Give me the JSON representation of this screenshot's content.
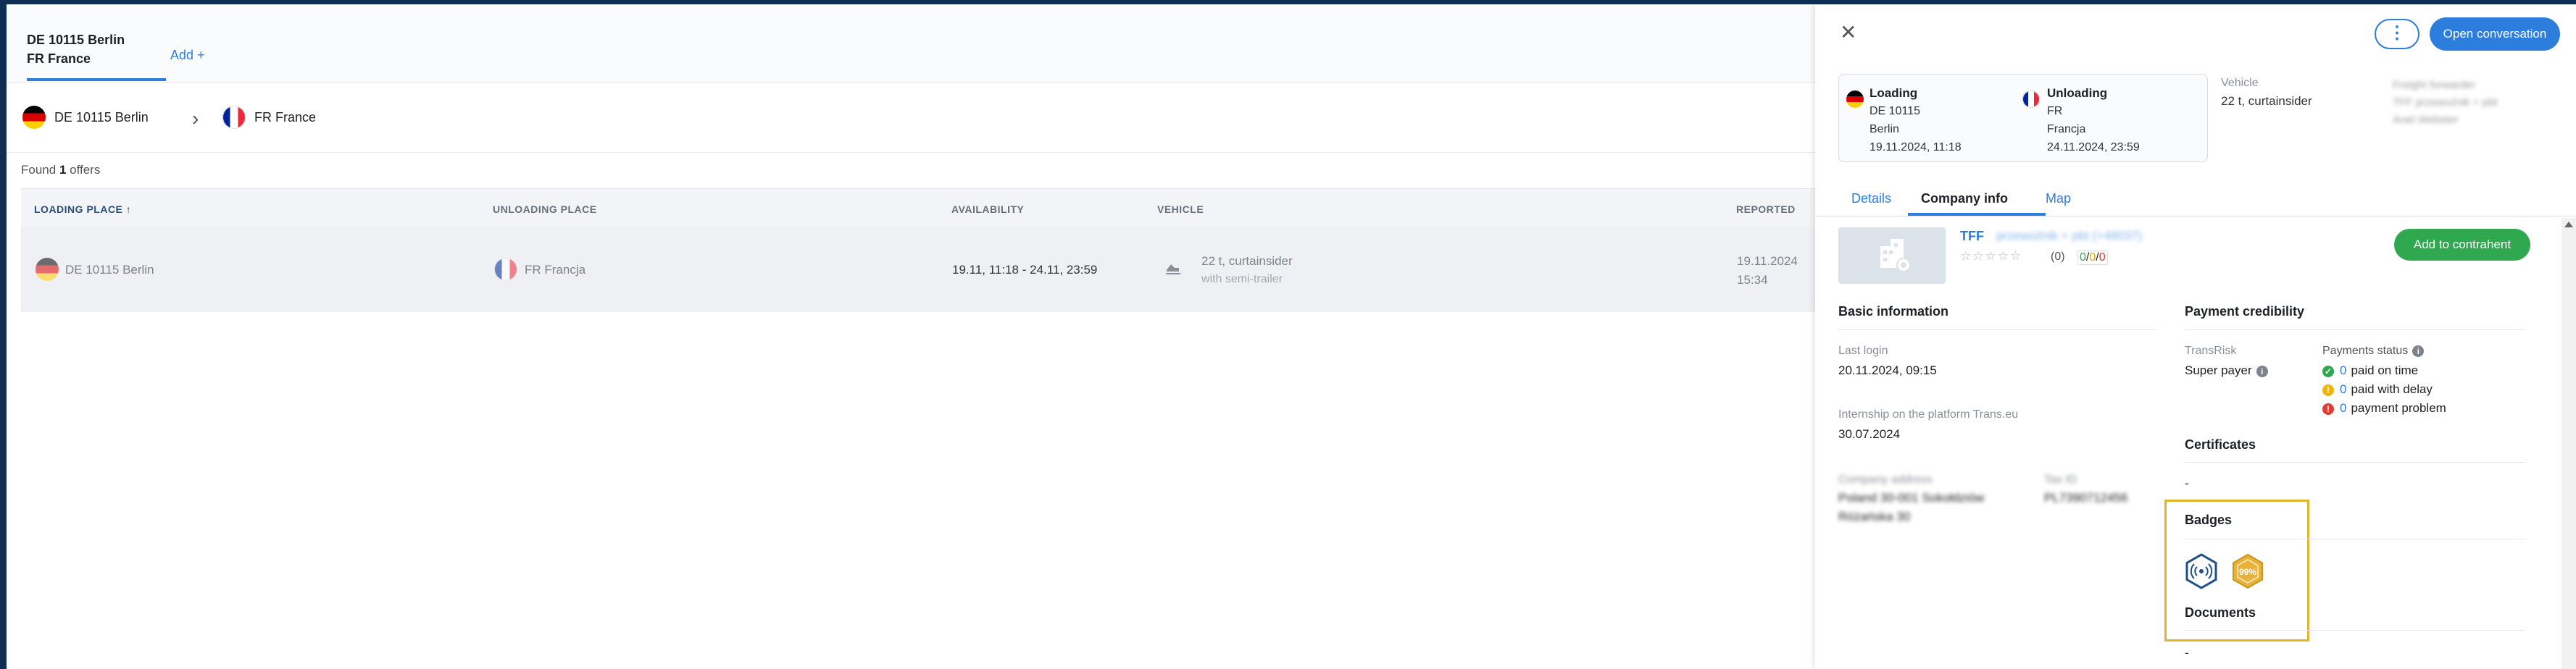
{
  "search_tab": {
    "line1": "DE 10115 Berlin",
    "line2": "FR France"
  },
  "add_tab": "Add +",
  "route": {
    "from": "DE 10115 Berlin",
    "to": "FR France"
  },
  "found": {
    "prefix": "Found ",
    "count": "1",
    "suffix": " offers"
  },
  "table": {
    "headers": {
      "loading": "LOADING PLACE",
      "unloading": "UNLOADING PLACE",
      "availability": "AVAILABILITY",
      "vehicle": "VEHICLE",
      "reported": "REPORTED"
    },
    "row": {
      "loading": "DE 10115 Berlin",
      "unloading": "FR Francja",
      "availability": "19.11, 11:18 - 24.11, 23:59",
      "vehicle_line1": "22 t, curtainsider",
      "vehicle_line2": "with semi-trailer",
      "reported_date": "19.11.2024",
      "reported_time": "15:34"
    }
  },
  "drawer": {
    "close": "✕",
    "more": "⋮",
    "open_conversation": "Open conversation",
    "loading": {
      "title": "Loading",
      "line1": "DE 10115",
      "line2": "Berlin",
      "line3": "19.11.2024, 11:18"
    },
    "unloading": {
      "title": "Unloading",
      "line1": "FR",
      "line2": "Francja",
      "line3": "24.11.2024, 23:59"
    },
    "vehicle_label": "Vehicle",
    "vehicle_value": "22 t, curtainsider",
    "forwarder_blur": [
      "Freight forwarder",
      "TFF przewoźnik + pbt",
      "Anet Webster"
    ],
    "tabs": [
      "Details",
      "Company info",
      "Map"
    ],
    "company": {
      "name": "TFF",
      "name_blur": "przewoźnik + pbt  (+48037)",
      "stars": "☆☆☆☆☆",
      "rating": "(0)",
      "ratio": {
        "a": "0",
        "b": "0",
        "c": "0"
      },
      "add_to_contrahent": "Add to contrahent"
    },
    "basic_info": {
      "title": "Basic information",
      "last_login_label": "Last login",
      "last_login_value": "20.11.2024, 09:15",
      "internship_label": "Internship on the platform Trans.eu",
      "internship_value": "30.07.2024",
      "blur_address_label": "Company address",
      "blur_address_value": [
        "Poland 30-001 Sokołdziów",
        "Różańska 30"
      ],
      "blur_tax_label": "Tax ID",
      "blur_tax_value": "PL7390712456"
    },
    "payment": {
      "title": "Payment credibility",
      "transrisk_label": "TransRisk",
      "transrisk_value": "Super payer",
      "status_label": "Payments status",
      "items": [
        {
          "count": "0",
          "label": "paid on time"
        },
        {
          "count": "0",
          "label": "paid with delay"
        },
        {
          "count": "0",
          "label": "payment problem"
        }
      ]
    },
    "certificates": {
      "title": "Certificates",
      "value": "-"
    },
    "badges": {
      "title": "Badges",
      "badge2_text": "99%"
    },
    "documents": {
      "title": "Documents",
      "value": "-"
    }
  }
}
